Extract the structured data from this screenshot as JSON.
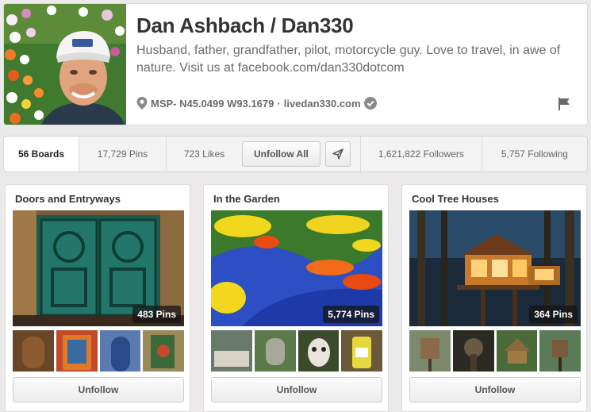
{
  "profile": {
    "name": "Dan Ashbach / Dan330",
    "bio": "Husband, father, grandfather, pilot, motorcycle guy. Love to travel, in awe of nature. Visit us at facebook.com/dan330dotcom",
    "location": "MSP- N45.0499 W93.1679",
    "separator": "·",
    "website": "livedan330.com",
    "icons": [
      "location-pin-icon",
      "verified-check-icon",
      "report-flag-icon"
    ]
  },
  "stats": {
    "boards": "56 Boards",
    "pins": "17,729 Pins",
    "likes": "723 Likes",
    "unfollow_all": "Unfollow All",
    "followers": "1,621,822 Followers",
    "following": "5,757 Following",
    "icons": [
      "send-icon"
    ]
  },
  "boards": [
    {
      "title": "Doors and Entryways",
      "pins": "483 Pins",
      "button": "Unfollow"
    },
    {
      "title": "In the Garden",
      "pins": "5,774 Pins",
      "button": "Unfollow"
    },
    {
      "title": "Cool Tree Houses",
      "pins": "364 Pins",
      "button": "Unfollow"
    }
  ],
  "colors": {
    "background": "#ebe9e9",
    "text": "#333333",
    "muted": "#6b6b6b"
  }
}
